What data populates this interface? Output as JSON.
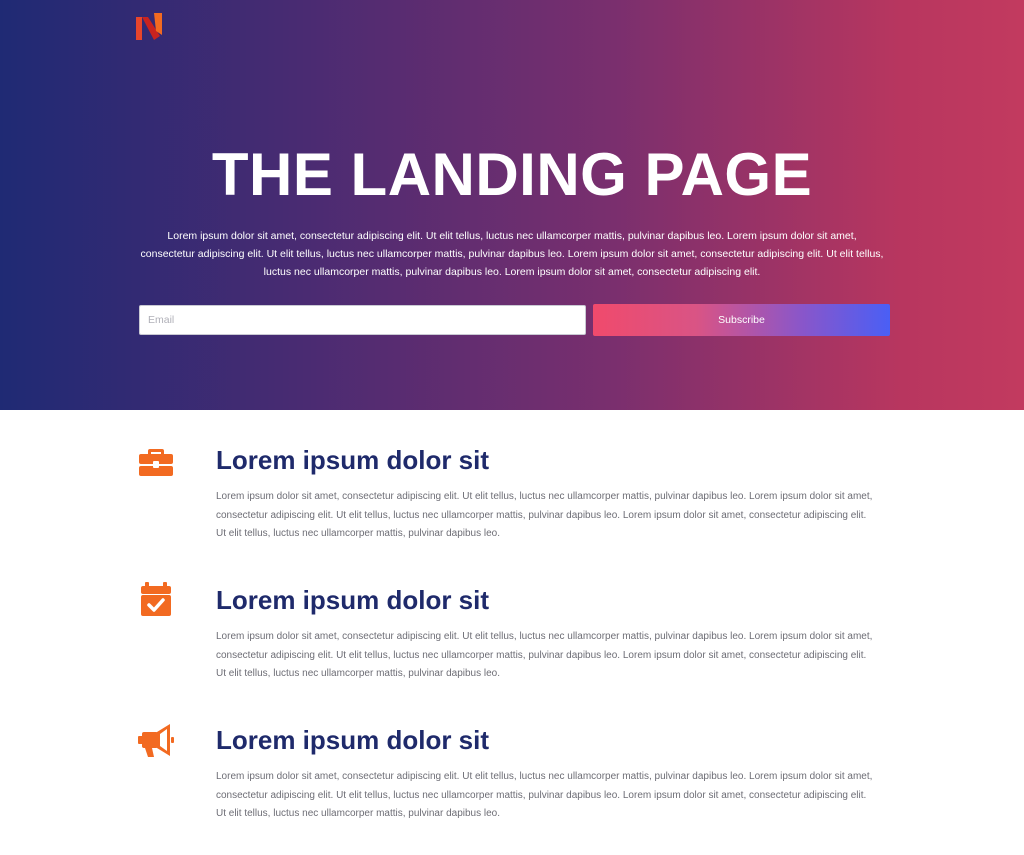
{
  "brand": {
    "logo_icon": "brand-n-logo-icon",
    "accent": "#f26a21"
  },
  "hero": {
    "title": "THE LANDING PAGE",
    "text": "Lorem ipsum dolor sit amet, consectetur adipiscing elit. Ut elit tellus, luctus nec ullamcorper mattis, pulvinar dapibus leo. Lorem ipsum dolor sit amet, consectetur adipiscing elit. Ut elit tellus, luctus nec ullamcorper mattis, pulvinar dapibus leo. Lorem ipsum dolor sit amet, consectetur adipiscing elit. Ut elit tellus, luctus nec ullamcorper mattis, pulvinar dapibus leo. Lorem ipsum dolor sit amet, consectetur adipiscing elit.",
    "email_placeholder": "Email",
    "subscribe_label": "Subscribe"
  },
  "features": [
    {
      "icon": "briefcase-icon",
      "title": "Lorem ipsum dolor sit",
      "text": "Lorem ipsum dolor sit amet, consectetur adipiscing elit. Ut elit tellus, luctus nec ullamcorper mattis, pulvinar dapibus leo. Lorem ipsum dolor sit amet, consectetur adipiscing elit. Ut elit tellus, luctus nec ullamcorper mattis, pulvinar dapibus leo. Lorem ipsum dolor sit amet, consectetur adipiscing elit. Ut elit tellus, luctus nec ullamcorper mattis, pulvinar dapibus leo."
    },
    {
      "icon": "calendar-check-icon",
      "title": "Lorem ipsum dolor sit",
      "text": "Lorem ipsum dolor sit amet, consectetur adipiscing elit. Ut elit tellus, luctus nec ullamcorper mattis, pulvinar dapibus leo. Lorem ipsum dolor sit amet, consectetur adipiscing elit. Ut elit tellus, luctus nec ullamcorper mattis, pulvinar dapibus leo. Lorem ipsum dolor sit amet, consectetur adipiscing elit. Ut elit tellus, luctus nec ullamcorper mattis, pulvinar dapibus leo."
    },
    {
      "icon": "megaphone-icon",
      "title": "Lorem ipsum dolor sit",
      "text": "Lorem ipsum dolor sit amet, consectetur adipiscing elit. Ut elit tellus, luctus nec ullamcorper mattis, pulvinar dapibus leo. Lorem ipsum dolor sit amet, consectetur adipiscing elit. Ut elit tellus, luctus nec ullamcorper mattis, pulvinar dapibus leo. Lorem ipsum dolor sit amet, consectetur adipiscing elit. Ut elit tellus, luctus nec ullamcorper mattis, pulvinar dapibus leo."
    }
  ]
}
